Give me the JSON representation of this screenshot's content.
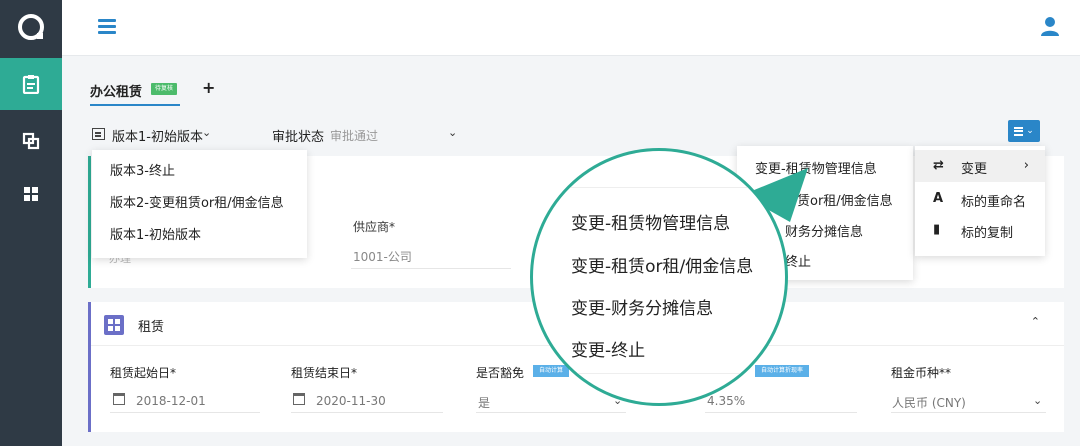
{
  "header": {
    "tab_title": "办公租赁",
    "tab_badge": "待复核",
    "add_tab": "+"
  },
  "version_bar": {
    "version_label": "版本1-初始版本",
    "approval_label": "审批状态",
    "approval_value": "审批通过"
  },
  "version_dropdown": {
    "options": [
      "版本3-终止",
      "版本2-变更租赁or租/佣金信息",
      "版本1-初始版本"
    ]
  },
  "supplier_card": {
    "supplier_label": "供应商*",
    "supplier_value": "1001-公司",
    "faded_value": "办理"
  },
  "lease_card": {
    "title": "租赁",
    "fields": [
      {
        "label": "租赁起始日*",
        "value": "2018-12-01"
      },
      {
        "label": "租赁结束日*",
        "value": "2020-11-30"
      },
      {
        "label": "是否豁免",
        "value": "是",
        "badge": "自动计算"
      },
      {
        "label": "",
        "value": "4.35%",
        "badge": "自动计算折现率"
      },
      {
        "label": "租金币种**",
        "value": "人民币 (CNY)"
      }
    ]
  },
  "change_submenu": {
    "options": [
      "变更-租赁物管理信息",
      "变更-租赁or租/佣金信息",
      "变更-财务分摊信息",
      "变更-终止"
    ],
    "visible_partial": [
      "变更-租赁物管理信息",
      "赁or租/佣金信息",
      "财务分摊信息",
      "终止"
    ]
  },
  "right_menu": {
    "items": [
      {
        "icon": "⇄",
        "label": "变更",
        "arrow": "›"
      },
      {
        "icon": "A",
        "label": "标的重命名"
      },
      {
        "icon": "▮",
        "label": "标的复制"
      }
    ]
  },
  "magnifier": {
    "options": [
      "变更-租赁物管理信息",
      "变更-租赁or租/佣金信息",
      "变更-财务分摊信息",
      "变更-终止"
    ]
  },
  "colors": {
    "accent": "#2eab95",
    "primary": "#2a86c8",
    "sidebar": "#2f3a45",
    "lease": "#6b6fc7"
  }
}
